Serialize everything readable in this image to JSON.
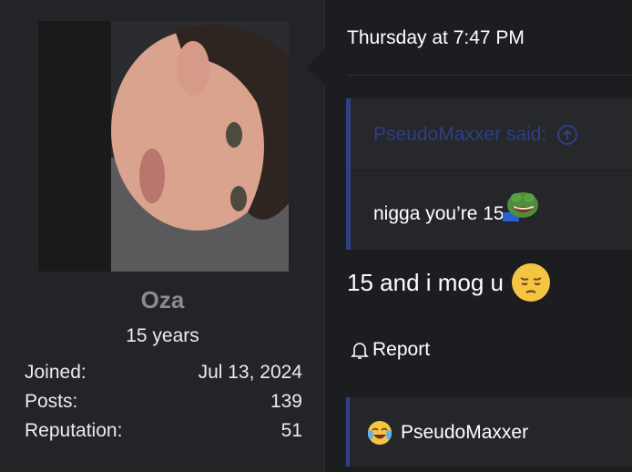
{
  "user": {
    "name": "Oza",
    "title": "15 years",
    "stats": [
      {
        "label": "Joined:",
        "value": "Jul 13, 2024"
      },
      {
        "label": "Posts:",
        "value": "139"
      },
      {
        "label": "Reputation:",
        "value": "51"
      }
    ]
  },
  "post": {
    "date": "Thursday at 7:47 PM",
    "quote": {
      "author_text": "PseudoMaxxer said:",
      "body": "nigga you’re 15"
    },
    "message": "15 and i mog u",
    "report_label": "Report",
    "reaction": {
      "user": "PseudoMaxxer"
    }
  },
  "colors": {
    "quote_accent": "#2f4184",
    "muted_name": "#8a8b8f",
    "background": "#1c1d20"
  },
  "icons": [
    "up-arrow-circle-icon",
    "pepe-laugh-emoji",
    "pensive-face-emoji",
    "bell-icon",
    "joy-face-emoji"
  ]
}
